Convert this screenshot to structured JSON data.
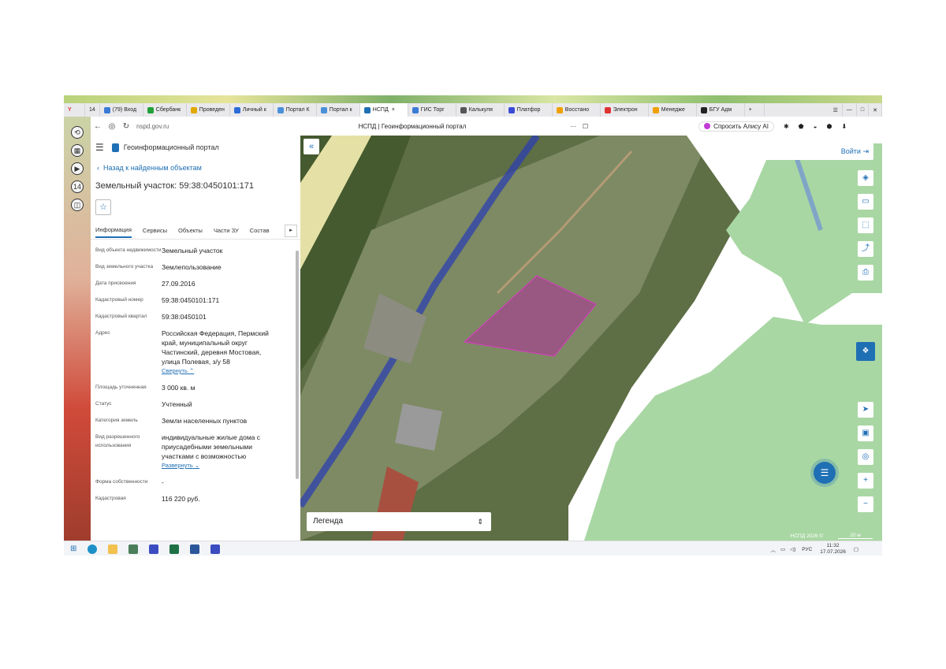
{
  "browser": {
    "tabs": [
      {
        "label": "14",
        "color": "#888888"
      },
      {
        "label": "(79) Вход",
        "color": "#3a7bd5"
      },
      {
        "label": "Сбербанк",
        "color": "#21a038"
      },
      {
        "label": "Проведен",
        "color": "#e0a800"
      },
      {
        "label": "Личный к",
        "color": "#2d6bd6"
      },
      {
        "label": "Портал К",
        "color": "#4a90d9"
      },
      {
        "label": "Портал к",
        "color": "#4a90d9"
      },
      {
        "label": "НСПД",
        "color": "#1f6fb4",
        "active": true
      },
      {
        "label": "ГИС Торг",
        "color": "#3a7bd5"
      },
      {
        "label": "Калькуля",
        "color": "#555555"
      },
      {
        "label": "Платфор",
        "color": "#3a4bd5"
      },
      {
        "label": "Восстано",
        "color": "#f0a000"
      },
      {
        "label": "Электрон",
        "color": "#d33"
      },
      {
        "label": "Менедже",
        "color": "#f0a000"
      },
      {
        "label": "БГУ Адм",
        "color": "#222222"
      }
    ],
    "url": "nspd.gov.ru",
    "page_title": "НСПД | Геоинформационный портал",
    "alice_label": "Спросить Алису AI"
  },
  "panel": {
    "portal_name": "Геоинформационный портал",
    "back_label": "Назад к найденным объектам",
    "title": "Земельный участок: 59:38:0450101:171",
    "tabs": [
      "Информация",
      "Сервисы",
      "Объекты",
      "Части ЗУ",
      "Состав"
    ],
    "rows": [
      {
        "label": "Вид объекта недвижимости",
        "value": "Земельный участок"
      },
      {
        "label": "Вид земельного участка",
        "value": "Землепользование"
      },
      {
        "label": "Дата присвоения",
        "value": "27.09.2016"
      },
      {
        "label": "Кадастровый номер",
        "value": "59:38:0450101:171"
      },
      {
        "label": "Кадастровый квартал",
        "value": "59:38:0450101"
      },
      {
        "label": "Адрес",
        "value": "Российская Федерация, Пермский край, муниципальный округ Частинский, деревня Мостовая, улица Полевая, з/у 58",
        "link": "Свернуть"
      },
      {
        "label": "Площадь уточненная",
        "value": "3 000 кв. м"
      },
      {
        "label": "Статус",
        "value": "Учтенный"
      },
      {
        "label": "Категория земель",
        "value": "Земли населенных пунктов"
      },
      {
        "label": "Вид разрешенного использования",
        "value": "индивидуальные жилые дома с приусадебными земельными участками с возможностью",
        "link": "Развернуть"
      },
      {
        "label": "Форма собственности",
        "value": "-"
      },
      {
        "label": "Кадастровая",
        "value": "116 220 руб."
      }
    ]
  },
  "map": {
    "login_label": "Войти",
    "legend_label": "Легенда",
    "copyright": "НСПД 2026 ©",
    "scale": "20 м",
    "parcel_color": "#b0309a",
    "forest_zone_color": "#a9d7a4"
  },
  "taskbar": {
    "lang": "РУС",
    "time": "11:32",
    "date": "17.07.2026"
  }
}
